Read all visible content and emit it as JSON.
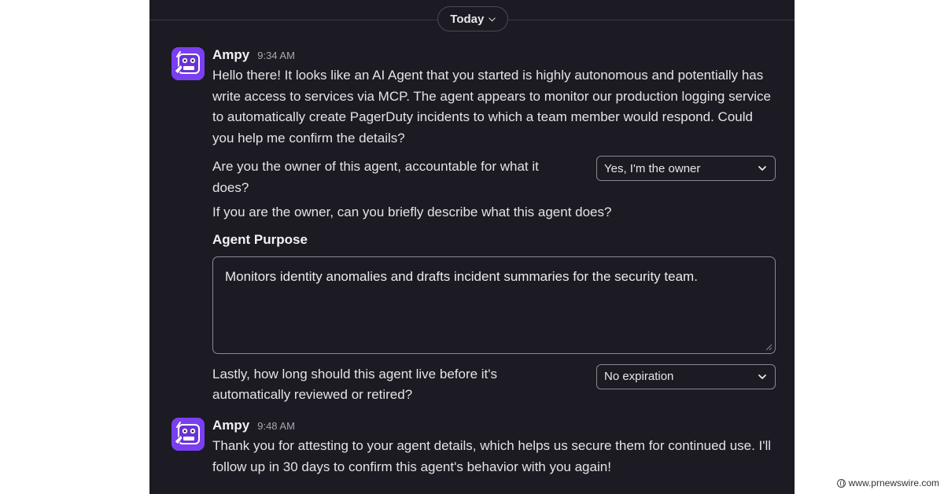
{
  "divider": {
    "date_label": "Today"
  },
  "messages": [
    {
      "author": "Ampy",
      "time": "9:34 AM",
      "text": "Hello there! It looks like an AI Agent that you started is highly autonomous and potentially has write access to services via MCP. The agent appears to monitor our production logging service to automatically create PagerDuty incidents to which a team member would respond. Could you help me confirm the details?",
      "owner_question": "Are you the owner of this agent, accountable for what it does?",
      "owner_select_value": "Yes, I'm the owner",
      "describe_prompt": "If you are the owner, can you briefly describe what this agent does?",
      "purpose_label": "Agent Purpose",
      "purpose_value": "Monitors identity anomalies and drafts incident summaries for the security team.",
      "lifetime_question": "Lastly, how long should this agent live before it's automatically reviewed or retired?",
      "lifetime_select_value": "No expiration"
    },
    {
      "author": "Ampy",
      "time": "9:48 AM",
      "text": "Thank you for attesting to your agent details, which helps us secure them for continued use. I'll follow up in 30 days to confirm this agent's behavior with you again!"
    }
  ],
  "icons": {
    "avatar": "ampy-robot-avatar-icon",
    "chevron": "chevron-down-icon",
    "grip": "resize-grip-icon"
  },
  "colors": {
    "background": "#1c1a22",
    "avatar": "#7c4dff",
    "text": "#e4e3e6"
  },
  "watermark": "www.prnewswire.com"
}
